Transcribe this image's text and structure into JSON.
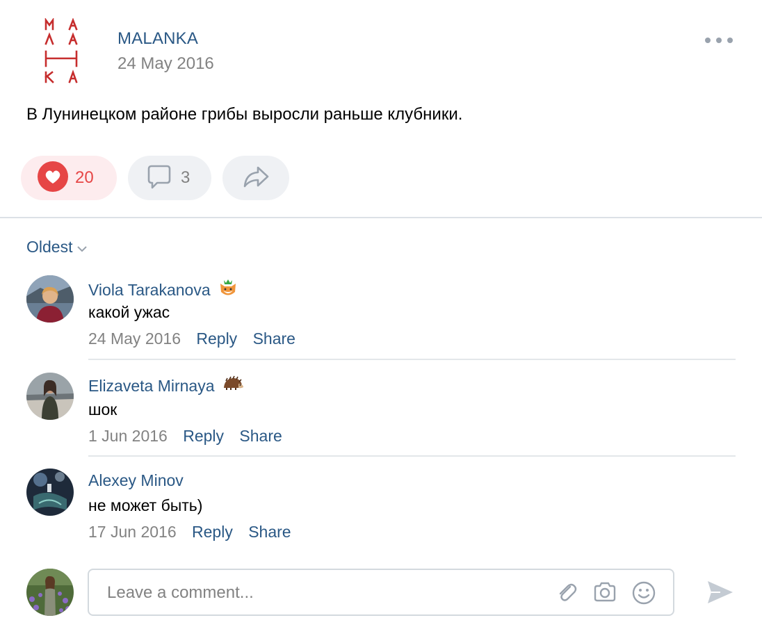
{
  "post": {
    "author": "MALANKA",
    "date": "24 May 2016",
    "text": "В Лунинецком районе грибы выросли раньше клубники.",
    "logo_letters": [
      "М",
      "А",
      "Л",
      "А",
      "Н",
      "К",
      "А"
    ],
    "likes": "20",
    "comments": "3",
    "liked": true
  },
  "comments_section": {
    "sort_label": "Oldest",
    "items": [
      {
        "author": "Viola Tarakanova",
        "emoji": "fox-face-with-crown-icon",
        "text": "какой ужас",
        "date": "24 May 2016",
        "reply": "Reply",
        "share": "Share"
      },
      {
        "author": "Elizaveta Mirnaya",
        "emoji": "hedgehog-icon",
        "text": "шок",
        "date": "1 Jun 2016",
        "reply": "Reply",
        "share": "Share"
      },
      {
        "author": "Alexey Minov",
        "text": "не может быть)",
        "date": "17 Jun 2016",
        "reply": "Reply",
        "share": "Share"
      }
    ]
  },
  "composer": {
    "placeholder": "Leave a comment...",
    "icons": [
      "paperclip-icon",
      "camera-icon",
      "smile-icon",
      "send-icon"
    ]
  },
  "colors": {
    "link": "#2a5885",
    "muted": "#828282",
    "like": "#e64646",
    "logo": "#c62d2d"
  }
}
